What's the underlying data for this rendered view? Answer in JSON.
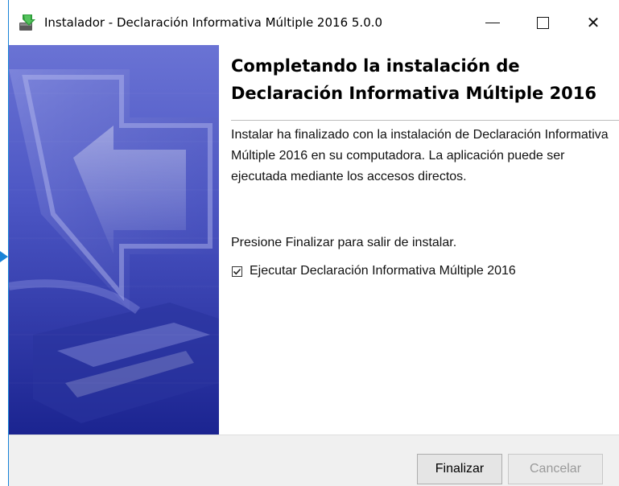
{
  "window": {
    "title": "Instalador - Declaración Informativa Múltiple 2016 5.0.0",
    "accent_color": "#1883d7"
  },
  "titlebar": {
    "app_icon": "installer-icon",
    "minimize_icon": "minimize-icon",
    "maximize_icon": "maximize-icon",
    "close_icon": "close-icon",
    "close_glyph": "✕"
  },
  "content": {
    "heading": "Completando la instalación de Declaración Informativa Múltiple 2016",
    "paragraph1": "Instalar ha finalizado con la instalación de Declaración Informativa Múltiple 2016 en su computadora. La aplicación puede ser ejecutada mediante los accesos directos.",
    "paragraph2": "Presione Finalizar para salir de instalar.",
    "run_checkbox": {
      "label": "Ejecutar Declaración Informativa Múltiple 2016",
      "checked": true
    }
  },
  "footer": {
    "finish_label": "Finalizar",
    "cancel_label": "Cancelar",
    "cancel_enabled": false
  },
  "colors": {
    "sidebar_top": "#6a73d4",
    "sidebar_bottom": "#1b2490"
  }
}
